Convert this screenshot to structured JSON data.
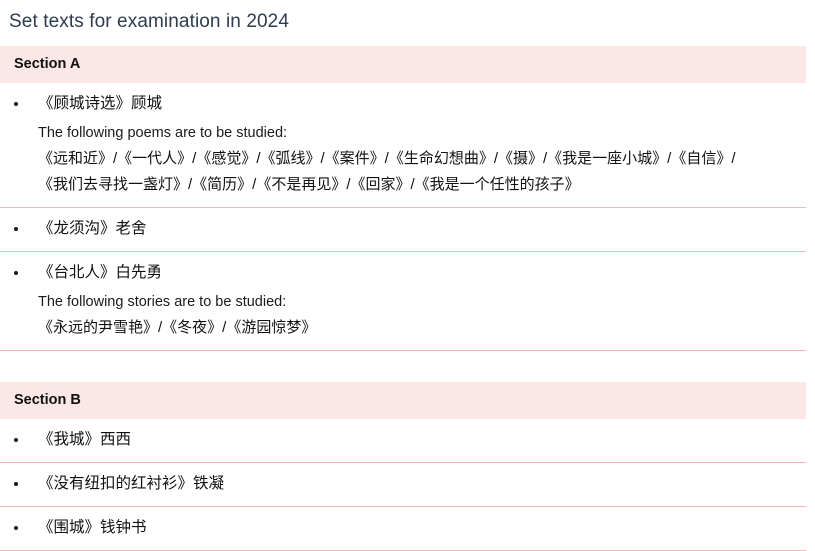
{
  "page": {
    "title": "Set texts for examination in 2024"
  },
  "sections": [
    {
      "header": "Section A",
      "items": [
        {
          "title": "《顾城诗选》顾城",
          "note": "The following poems are to be studied:",
          "works": [
            "《远和近》/《一代人》/《感觉》/《弧线》/《案件》/《生命幻想曲》/《摄》/《我是一座小城》/《自信》/",
            "《我们去寻找一盏灯》/《简历》/《不是再见》/《回家》/《我是一个任性的孩子》"
          ]
        },
        {
          "title": "《龙须沟》老舍",
          "note": "",
          "works": []
        },
        {
          "title": "《台北人》白先勇",
          "note": "The following stories are to be studied:",
          "works": [
            "《永远的尹雪艳》/《冬夜》/《游园惊梦》"
          ]
        }
      ]
    },
    {
      "header": "Section B",
      "items": [
        {
          "title": "《我城》西西",
          "note": "",
          "works": []
        },
        {
          "title": "《没有纽扣的红衬衫》铁凝",
          "note": "",
          "works": []
        },
        {
          "title": "《围城》钱钟书",
          "note": "",
          "works": []
        }
      ]
    }
  ],
  "colors": {
    "header_band": "#fbe7e5",
    "separator": "#f4b6bb",
    "title_text": "#2e3c4f",
    "body_text": "#111111"
  }
}
